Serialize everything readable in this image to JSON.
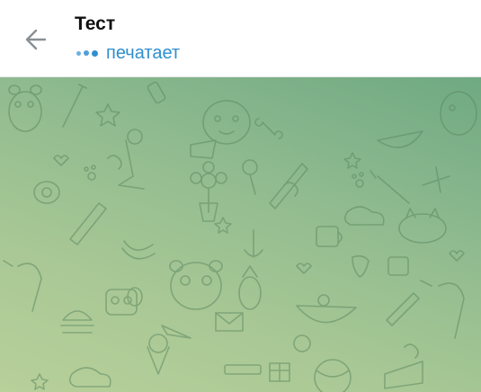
{
  "header": {
    "title": "Тест",
    "status": "печатает",
    "back_icon": "arrow-left-icon"
  },
  "background": {
    "pattern": "doodle-wallpaper",
    "colors": {
      "top": "#6fa982",
      "bottom": "#b8d09a",
      "doodle": "#5e8a63"
    }
  },
  "colors": {
    "accent": "#2f8fcf",
    "title": "#111111"
  }
}
